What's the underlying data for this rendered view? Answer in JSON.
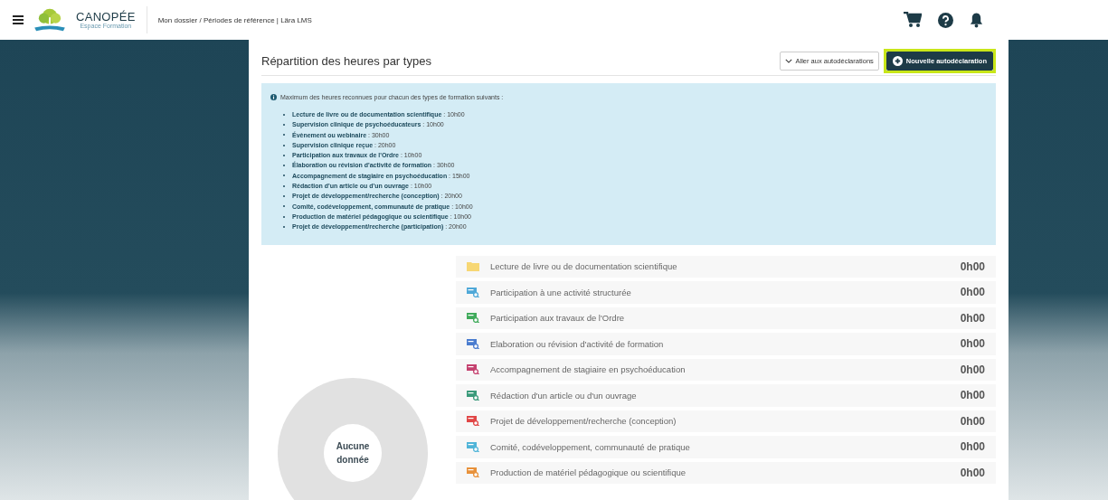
{
  "header": {
    "logo_name": "CANOPÉE",
    "logo_tagline": "Espace Formation",
    "breadcrumb": "Mon dossier / Périodes de référence | Lära LMS"
  },
  "section": {
    "title": "Répartition des heures par types",
    "actions": [
      {
        "kind": "dropdown",
        "label": "Aller aux autodéclarations",
        "highlighted": false
      },
      {
        "kind": "primary",
        "label": "Nouvelle autodéclaration",
        "highlighted": true
      }
    ]
  },
  "info": {
    "intro": "Maximum des heures reconnues pour chacun des types de formation suivants :",
    "items": [
      {
        "name": "Lecture de livre ou de documentation scientifique",
        "hours": " : 10h00"
      },
      {
        "name": "Supervision clinique de psychoéducateurs",
        "hours": " : 10h00"
      },
      {
        "name": "Évènement ou webinaire",
        "hours": " : 30h00"
      },
      {
        "name": "Supervision clinique reçue",
        "hours": " : 20h00"
      },
      {
        "name": "Participation aux travaux de l'Ordre",
        "hours": " : 10h00"
      },
      {
        "name": "Élaboration ou révision d'activité de formation",
        "hours": " : 30h00"
      },
      {
        "name": "Accompagnement de stagiaire en psychoéducation",
        "hours": " : 15h00"
      },
      {
        "name": "Rédaction d'un article ou d'un ouvrage",
        "hours": " : 10h00"
      },
      {
        "name": "Projet de développement/recherche (conception)",
        "hours": " : 20h00"
      },
      {
        "name": "Comité, codéveloppement, communauté de pratique",
        "hours": " : 10h00"
      },
      {
        "name": "Production de matériel pédagogique ou scientifique",
        "hours": " : 10h00"
      },
      {
        "name": "Projet de développement/recherche (participation)",
        "hours": " : 20h00"
      }
    ]
  },
  "donut": {
    "empty_label": "Aucune donnée"
  },
  "types": [
    {
      "kind": "folder",
      "label": "Lecture de livre ou de documentation scientifique",
      "total": "0h00",
      "color": "#f7d774"
    },
    {
      "kind": "activity",
      "label": "Participation à une activité structurée",
      "total": "0h00",
      "color": "#4fa8d8"
    },
    {
      "kind": "activity",
      "label": "Participation aux travaux de l'Ordre",
      "total": "0h00",
      "color": "#3faa5a"
    },
    {
      "kind": "activity",
      "label": "Elaboration ou révision d'activité de formation",
      "total": "0h00",
      "color": "#4a7ccf"
    },
    {
      "kind": "activity",
      "label": "Accompagnement de stagiaire en psychoéducation",
      "total": "0h00",
      "color": "#c4406e"
    },
    {
      "kind": "activity",
      "label": "Rédaction d'un article ou d'un ouvrage",
      "total": "0h00",
      "color": "#3a9a7a"
    },
    {
      "kind": "activity",
      "label": "Projet de développement/recherche (conception)",
      "total": "0h00",
      "color": "#e04646"
    },
    {
      "kind": "activity",
      "label": "Comité, codéveloppement, communauté de pratique",
      "total": "0h00",
      "color": "#4fb4d8"
    },
    {
      "kind": "activity",
      "label": "Production de matériel pédagogique ou scientifique",
      "total": "0h00",
      "color": "#e8913a"
    }
  ]
}
